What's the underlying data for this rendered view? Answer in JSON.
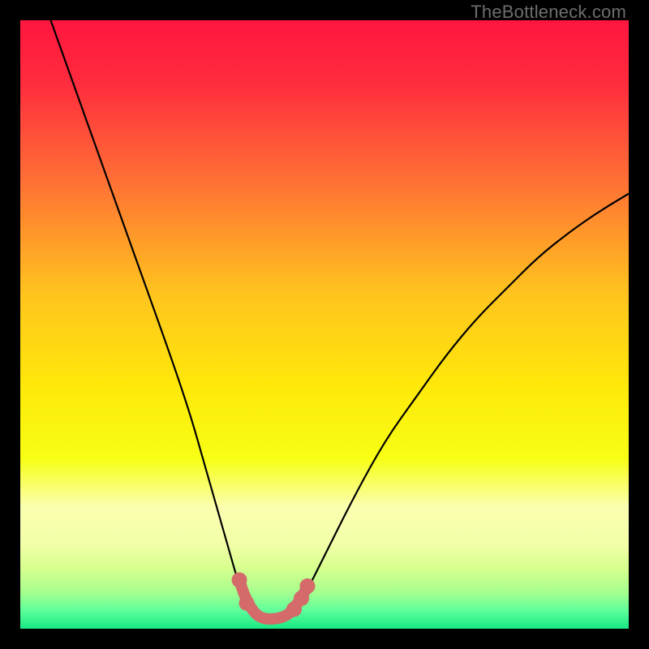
{
  "watermark": {
    "text": "TheBottleneck.com"
  },
  "chart_data": {
    "type": "line",
    "title": "",
    "xlabel": "",
    "ylabel": "",
    "xlim": [
      0,
      100
    ],
    "ylim": [
      0,
      100
    ],
    "grid": false,
    "legend": false,
    "background": {
      "type": "vertical-gradient",
      "stops": [
        {
          "pos": 0.0,
          "color": "#ff163f"
        },
        {
          "pos": 0.1,
          "color": "#ff2b3e"
        },
        {
          "pos": 0.25,
          "color": "#ff6a36"
        },
        {
          "pos": 0.45,
          "color": "#ffc41e"
        },
        {
          "pos": 0.6,
          "color": "#ffe80a"
        },
        {
          "pos": 0.72,
          "color": "#f7ff14"
        },
        {
          "pos": 0.8,
          "color": "#fbffb0"
        },
        {
          "pos": 0.86,
          "color": "#f3ffa8"
        },
        {
          "pos": 0.9,
          "color": "#d8ff8e"
        },
        {
          "pos": 0.94,
          "color": "#a6ff8e"
        },
        {
          "pos": 0.97,
          "color": "#5eff9a"
        },
        {
          "pos": 1.0,
          "color": "#17e884"
        }
      ]
    },
    "series": [
      {
        "name": "bottleneck-curve",
        "stroke": "#000000",
        "stroke_width": 2.2,
        "x": [
          5,
          10,
          15,
          20,
          25,
          28,
          30,
          32,
          34,
          36,
          37.5,
          39,
          41,
          43,
          45,
          47,
          50,
          55,
          60,
          65,
          70,
          75,
          80,
          85,
          90,
          95,
          100
        ],
        "y": [
          100,
          86,
          72,
          58,
          44,
          35,
          28,
          21,
          14,
          7,
          3,
          1.5,
          1.5,
          1.5,
          3,
          6,
          12,
          22,
          31,
          38,
          45,
          51,
          56,
          61,
          65,
          68.5,
          71.5
        ]
      }
    ],
    "highlight": {
      "name": "optimal-zone",
      "stroke": "#d46a6a",
      "stroke_width": 14,
      "linecap": "round",
      "points_xy": [
        [
          36.0,
          8.0
        ],
        [
          37.0,
          5.0
        ],
        [
          38.5,
          2.5
        ],
        [
          40.0,
          1.6
        ],
        [
          42.0,
          1.6
        ],
        [
          44.0,
          2.2
        ],
        [
          45.5,
          4.0
        ],
        [
          47.0,
          6.5
        ]
      ],
      "dots_xy": [
        [
          36.0,
          8.0
        ],
        [
          37.2,
          4.2
        ],
        [
          45.0,
          3.2
        ],
        [
          46.2,
          5.0
        ],
        [
          47.2,
          7.0
        ]
      ]
    }
  }
}
